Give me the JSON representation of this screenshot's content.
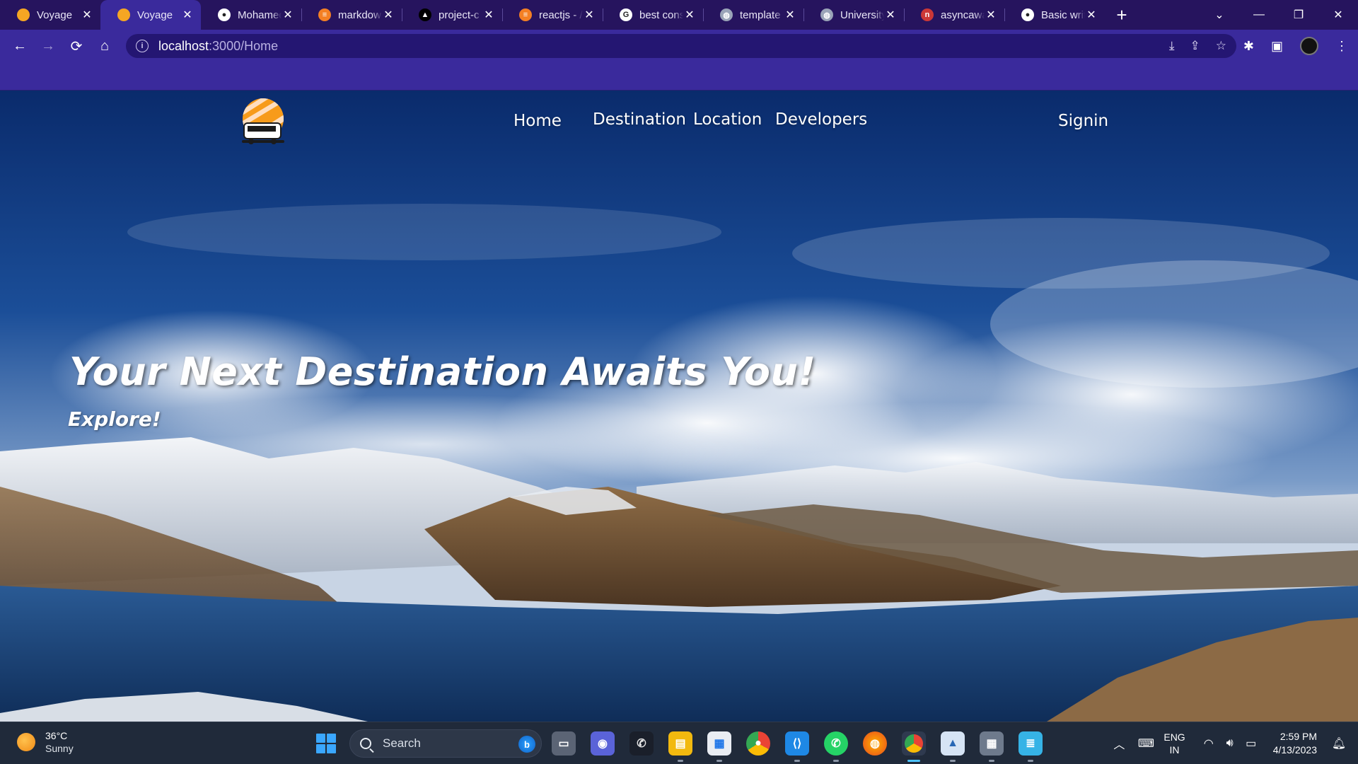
{
  "browser": {
    "tabs": [
      {
        "title": "Voyage",
        "favicon": "voyage-logo-icon",
        "active": false
      },
      {
        "title": "Voyage",
        "favicon": "voyage-logo-icon",
        "active": true
      },
      {
        "title": "Mohamed",
        "favicon": "github-icon",
        "active": false
      },
      {
        "title": "markdown",
        "favicon": "stackoverflow-icon",
        "active": false
      },
      {
        "title": "project-c",
        "favicon": "vercel-icon",
        "active": false
      },
      {
        "title": "reactjs - /",
        "favicon": "stackoverflow-icon",
        "active": false
      },
      {
        "title": "best cons",
        "favicon": "google-icon",
        "active": false
      },
      {
        "title": "template",
        "favicon": "globe-icon",
        "active": false
      },
      {
        "title": "University",
        "favicon": "globe-icon",
        "active": false
      },
      {
        "title": "asyncawa",
        "favicon": "npm-icon",
        "active": false
      },
      {
        "title": "Basic writ",
        "favicon": "github-icon",
        "active": false
      }
    ],
    "omnibox": {
      "host": "localhost",
      "path": ":3000/Home"
    }
  },
  "site": {
    "nav": {
      "home": "Home",
      "destination": "Destination",
      "location": "Location",
      "developers": "Developers",
      "signin": "Signin"
    },
    "hero": {
      "title": "Your Next Destination Awaits You!",
      "subtitle": "Explore!"
    }
  },
  "taskbar": {
    "weather": {
      "temp": "36°C",
      "condition": "Sunny"
    },
    "search_label": "Search",
    "language": {
      "line1": "ENG",
      "line2": "IN"
    },
    "clock": {
      "time": "2:59 PM",
      "date": "4/13/2023"
    }
  },
  "colors": {
    "tab_strip": "#26145e",
    "toolbar": "#3a2a9c",
    "taskbar": "#202a3a",
    "windows_accent": "#4cc2ff"
  }
}
